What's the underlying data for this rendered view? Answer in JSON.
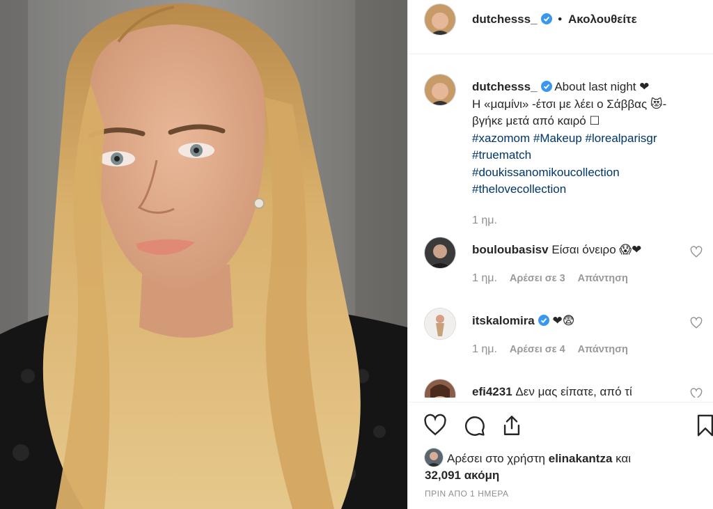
{
  "post": {
    "image_alt": "Portrait photo",
    "author": "dutchesss_",
    "follow_status": "Ακολουθείτε",
    "separator": "•"
  },
  "caption": {
    "username": "dutchesss_",
    "text_line1": "About last night ❤",
    "text_line2": "Η «μαμίνι» -έτσι με λέει ο Σάββας 😻-",
    "text_line3": "βγήκε μετά από καιρό ☐",
    "hashtag_line1": "#xazomom #Makeup #lorealparisgr",
    "hashtag_line2": "#truematch",
    "hashtag_line3": "#doukissanomikoucollection",
    "hashtag_line4": "#thelovecollection",
    "time": "1 ημ."
  },
  "comments": [
    {
      "username": "bouloubasisv",
      "text": "Είσαι όνειρο 😱❤",
      "verified": false,
      "time": "1 ημ.",
      "likes": "Αρέσει σε 3",
      "reply": "Απάντηση"
    },
    {
      "username": "itskalomira",
      "text": "❤😨",
      "verified": true,
      "time": "1 ημ.",
      "likes": "Αρέσει σε 4",
      "reply": "Απάντηση"
    },
    {
      "username": "efi4231",
      "text": "Δεν μας είπατε, από τί",
      "verified": false
    }
  ],
  "likes": {
    "prefix": "Αρέσει στο χρήστη",
    "user": "elinakantza",
    "conj": "και",
    "count": "32,091 ακόμη"
  },
  "timestamp": "ΠΡΙΝ ΑΠΟ 1 ΗΜΕΡΑ",
  "colors": {
    "hashtag": "#003569",
    "verified": "#3897f0",
    "muted": "#8e8e8e"
  }
}
